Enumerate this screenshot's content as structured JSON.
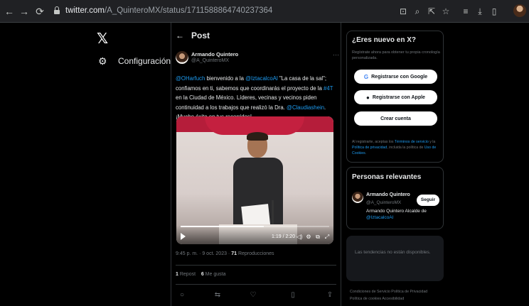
{
  "browser": {
    "url_host": "twitter.com",
    "url_path": "/A_QuinteroMX/status/1711588864740237364",
    "icons": [
      "back-icon",
      "forward-icon",
      "reload-icon",
      "lock-icon",
      "install-icon",
      "zoom-icon",
      "share-icon",
      "star-icon",
      "media-control-icon",
      "download-icon",
      "sidepanel-icon",
      "profile-avatar"
    ]
  },
  "nav": {
    "logo": "𝕏",
    "settings_label": "Configuración"
  },
  "post": {
    "back_glyph": "←",
    "header_title": "Post",
    "author_name": "Armando Quintero",
    "author_handle": "@A_QuinteroMX",
    "more_glyph": "···",
    "text_parts": [
      {
        "text": "@OHarfuch",
        "link": true
      },
      {
        "text": " bienvenido a la ",
        "link": false
      },
      {
        "text": "@IztacalcoAl",
        "link": true
      },
      {
        "text": " \"La casa de la sal\"; confiamos en ti, sabemos que coordinarás el proyecto de la ",
        "link": false
      },
      {
        "text": "#4T",
        "link": true
      },
      {
        "text": " en la Ciudad de México. Líderes, vecinas y vecinos piden continuidad a los trabajos que realizó la Dra. ",
        "link": false
      },
      {
        "text": "@Claudiashein",
        "link": true
      },
      {
        "text": ". ¡Mucho éxito en tus recorridos!",
        "link": false
      }
    ],
    "video": {
      "time": "1:19 / 2:20",
      "progress": 0.56
    },
    "timestamp": "9:45 p. m. · 9 oct. 2023 · ",
    "views_count": "71",
    "views_label": " Reproducciones",
    "reposts_count": "1",
    "reposts_label": " Repost",
    "likes_count": "6",
    "likes_label": " Me gusta"
  },
  "sidebar": {
    "signup_title": "¿Eres nuevo en X?",
    "signup_sub": "Regístrate ahora para obtener tu propia cronología personalizada.",
    "google_label": "Registrarse con Google",
    "apple_label": "Registrarse con Apple",
    "create_label": "Crear cuenta",
    "legal_parts": [
      {
        "text": "Al registrarte, aceptas los ",
        "link": false
      },
      {
        "text": "Términos de servicio",
        "link": true
      },
      {
        "text": " y la ",
        "link": false
      },
      {
        "text": "Política de privacidad",
        "link": true
      },
      {
        "text": ", incluida la política de ",
        "link": false
      },
      {
        "text": "Uso de Cookies",
        "link": true
      },
      {
        "text": ".",
        "link": false
      }
    ],
    "people_title": "Personas relevantes",
    "person_name": "Armando Quintero",
    "person_handle": "@A_QuinteroMX",
    "follow_label": "Seguir",
    "person_bio": "Armando Quintero Alcalde de ",
    "person_bio_link": "@IztacalcoAl",
    "trends_text": "Las tendencias no están disponibles.",
    "footer_line1": "Condiciones de Servicio   Política de Privacidad",
    "footer_line2": "Política de cookies   Accesibilidad"
  }
}
